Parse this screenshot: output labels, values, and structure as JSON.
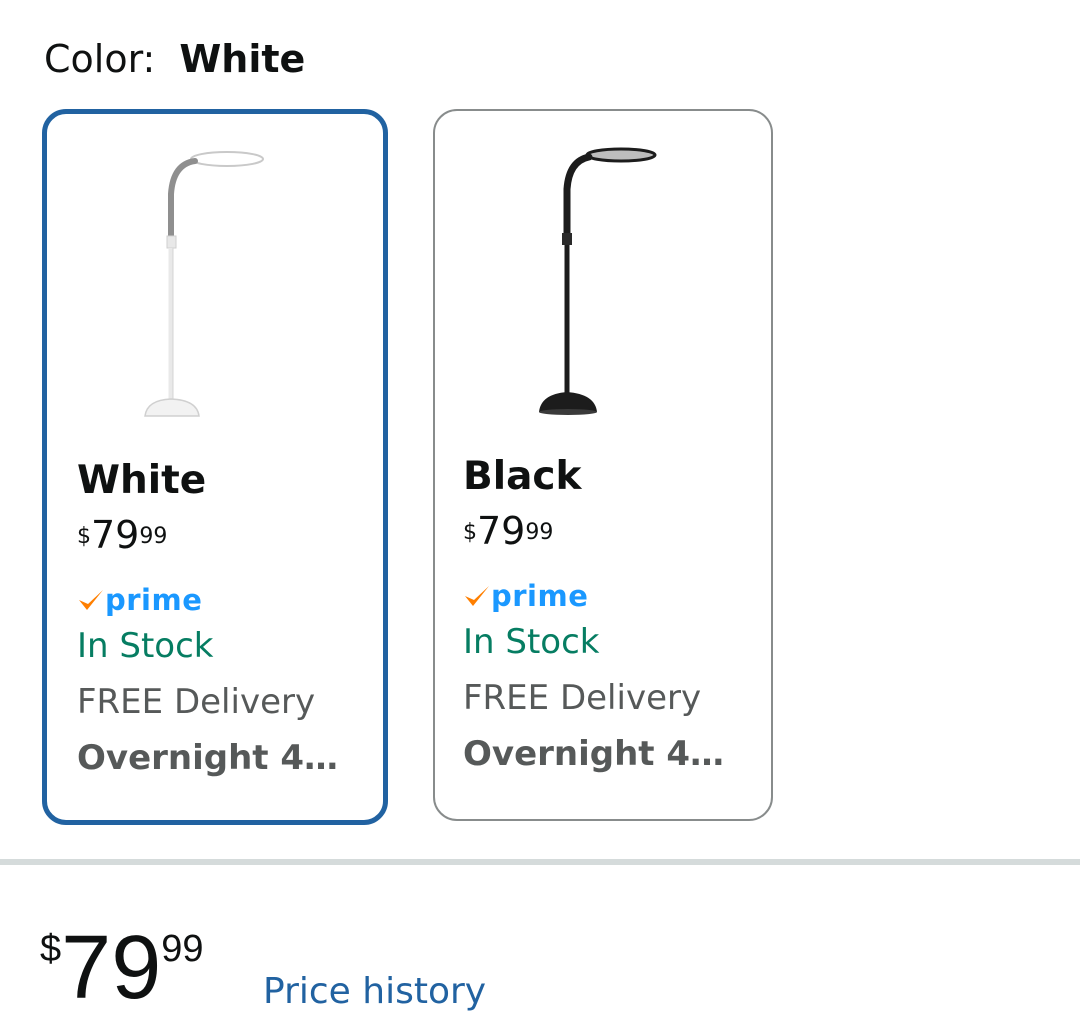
{
  "color_selector": {
    "label": "Color:",
    "selected_value": "White"
  },
  "variants": [
    {
      "name": "White",
      "price_symbol": "$",
      "price_whole": "79",
      "price_cents": "99",
      "prime_label": "prime",
      "stock": "In Stock",
      "delivery": "FREE Delivery",
      "delivery_speed": "Overnight 4…",
      "selected": true,
      "lamp_color": "#f4f4f4"
    },
    {
      "name": "Black",
      "price_symbol": "$",
      "price_whole": "79",
      "price_cents": "99",
      "prime_label": "prime",
      "stock": "In Stock",
      "delivery": "FREE Delivery",
      "delivery_speed": "Overnight 4…",
      "selected": false,
      "lamp_color": "#1c1c1c"
    }
  ],
  "price": {
    "symbol": "$",
    "whole": "79",
    "cents": "99"
  },
  "price_history_link": "Price history",
  "colors": {
    "selected_border": "#2162a1",
    "unselected_border": "#888c8c",
    "stock_green": "#067d62",
    "prime_blue": "#1a98ff",
    "prime_check": "#ff7f00",
    "link_blue": "#2162a1",
    "divider": "#d5dbdb"
  },
  "icons": {
    "prime_check": "prime-check-icon"
  }
}
